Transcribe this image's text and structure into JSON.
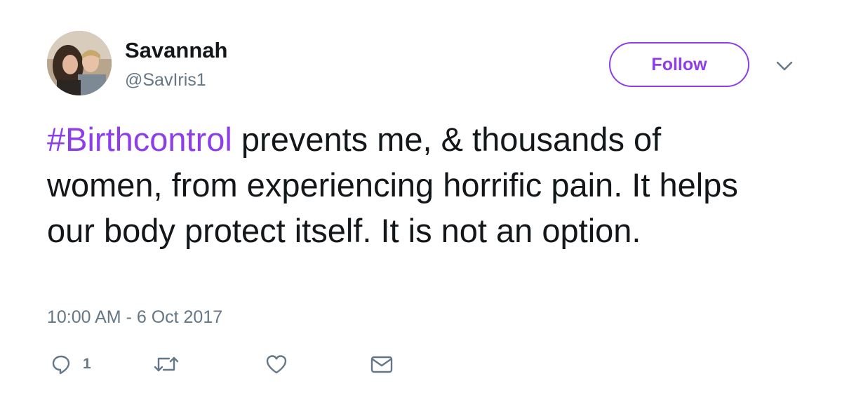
{
  "author": {
    "display_name": "Savannah",
    "handle": "@SavIris1"
  },
  "header": {
    "follow_label": "Follow"
  },
  "tweet": {
    "hashtag": "#Birthcontrol",
    "body": " prevents me, & thousands of women, from experiencing horrific pain. It helps our body protect itself. It is not an option.",
    "timestamp": "10:00 AM - 6 Oct 2017"
  },
  "actions": {
    "reply_count": "1",
    "icons": [
      "reply-icon",
      "retweet-icon",
      "like-icon",
      "direct-message-icon",
      "chevron-down-icon"
    ]
  },
  "colors": {
    "accent": "#8d3ee8",
    "text": "#14171a",
    "secondary": "#657786"
  }
}
